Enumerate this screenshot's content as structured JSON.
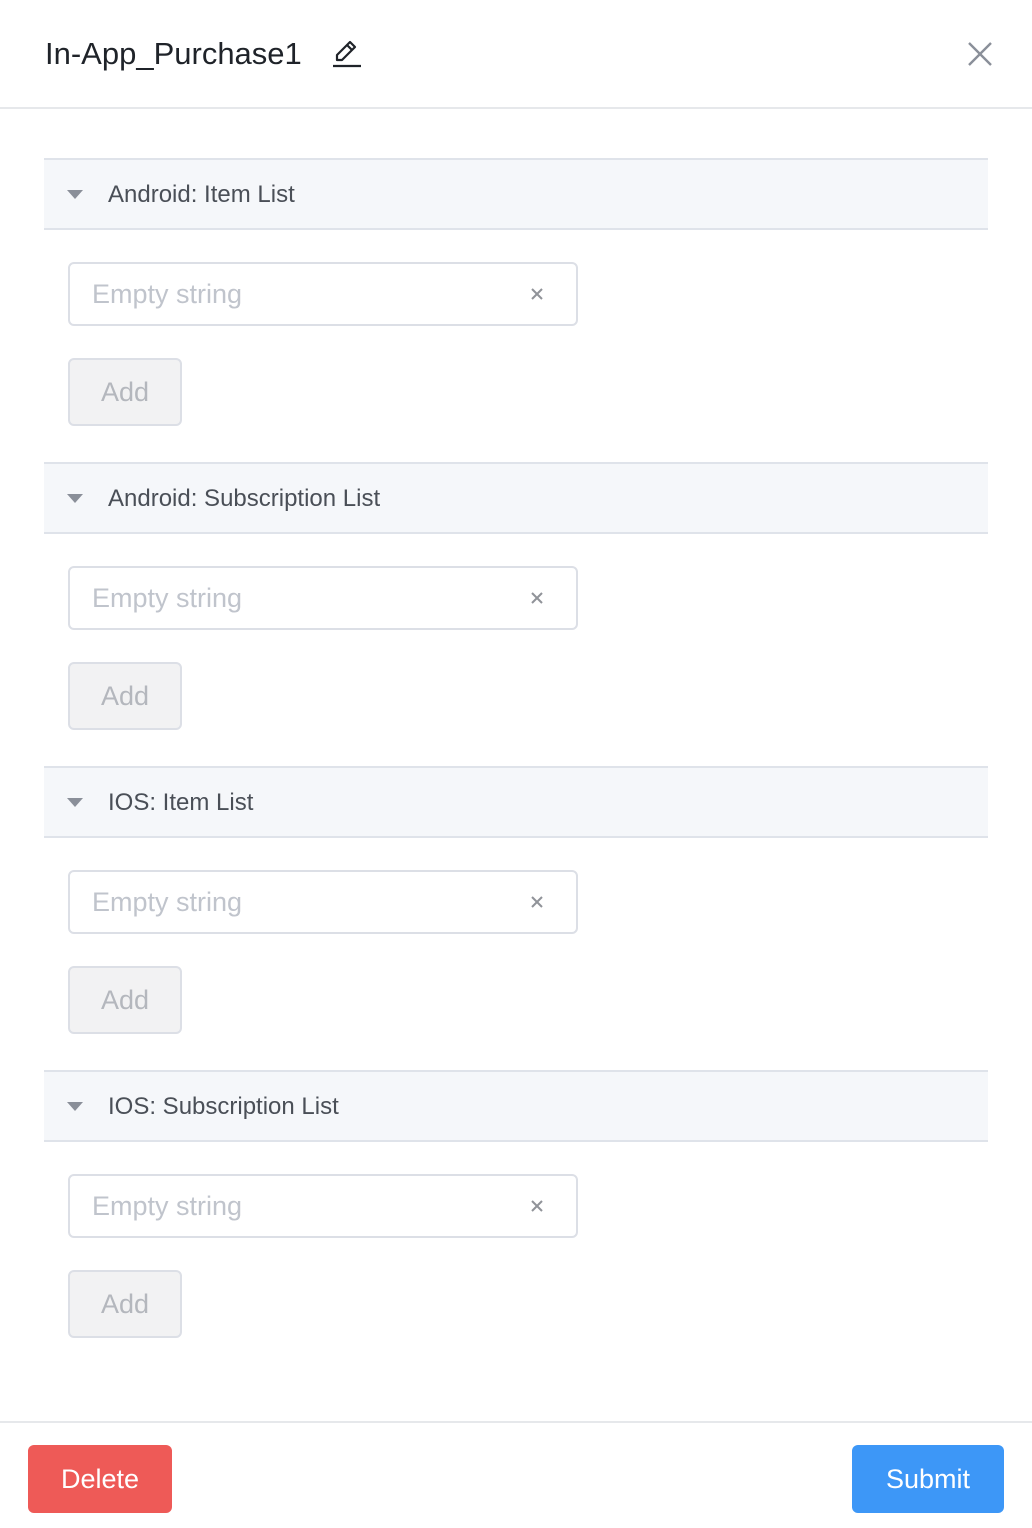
{
  "dialog": {
    "title": "In-App_Purchase1",
    "edit_icon": "pencil-icon",
    "close_icon": "close-icon"
  },
  "sections": [
    {
      "title": "Android: Item List",
      "input_placeholder": "Empty string",
      "input_value": "",
      "add_label": "Add"
    },
    {
      "title": "Android: Subscription List",
      "input_placeholder": "Empty string",
      "input_value": "",
      "add_label": "Add"
    },
    {
      "title": "IOS: Item List",
      "input_placeholder": "Empty string",
      "input_value": "",
      "add_label": "Add"
    },
    {
      "title": "IOS: Subscription List",
      "input_placeholder": "Empty string",
      "input_value": "",
      "add_label": "Add"
    }
  ],
  "footer": {
    "delete_label": "Delete",
    "submit_label": "Submit"
  },
  "colors": {
    "delete": "#ee5a57",
    "submit": "#3d97f7",
    "section_bg": "#f5f7fa"
  }
}
